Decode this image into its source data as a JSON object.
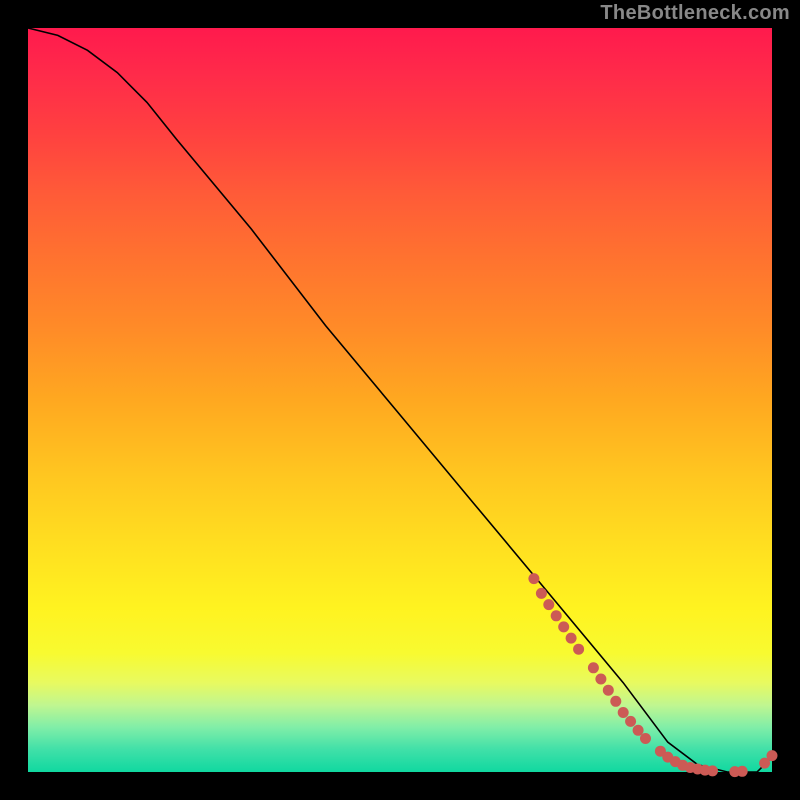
{
  "attribution": "TheBottleneck.com",
  "chart_data": {
    "type": "line",
    "title": "",
    "xlabel": "",
    "ylabel": "",
    "xlim": [
      0,
      100
    ],
    "ylim": [
      0,
      100
    ],
    "grid": false,
    "legend": false,
    "series": [
      {
        "name": "curve",
        "kind": "line",
        "x": [
          0,
          4,
          8,
          12,
          16,
          20,
          30,
          40,
          50,
          60,
          70,
          80,
          86,
          90,
          94,
          98,
          100
        ],
        "y": [
          100,
          99,
          97,
          94,
          90,
          85,
          73,
          60,
          48,
          36,
          24,
          12,
          4,
          1,
          0,
          0,
          2
        ]
      },
      {
        "name": "markers",
        "kind": "scatter",
        "points": [
          {
            "x": 68,
            "y": 26
          },
          {
            "x": 69,
            "y": 24
          },
          {
            "x": 70,
            "y": 22.5
          },
          {
            "x": 71,
            "y": 21
          },
          {
            "x": 72,
            "y": 19.5
          },
          {
            "x": 73,
            "y": 18
          },
          {
            "x": 74,
            "y": 16.5
          },
          {
            "x": 76,
            "y": 14
          },
          {
            "x": 77,
            "y": 12.5
          },
          {
            "x": 78,
            "y": 11
          },
          {
            "x": 79,
            "y": 9.5
          },
          {
            "x": 80,
            "y": 8
          },
          {
            "x": 81,
            "y": 6.8
          },
          {
            "x": 82,
            "y": 5.6
          },
          {
            "x": 83,
            "y": 4.5
          },
          {
            "x": 85,
            "y": 2.8
          },
          {
            "x": 86,
            "y": 2
          },
          {
            "x": 87,
            "y": 1.4
          },
          {
            "x": 88,
            "y": 0.9
          },
          {
            "x": 89,
            "y": 0.6
          },
          {
            "x": 90,
            "y": 0.4
          },
          {
            "x": 91,
            "y": 0.25
          },
          {
            "x": 92,
            "y": 0.15
          },
          {
            "x": 95,
            "y": 0.05
          },
          {
            "x": 96,
            "y": 0.1
          },
          {
            "x": 99,
            "y": 1.2
          },
          {
            "x": 100,
            "y": 2.2
          }
        ]
      }
    ]
  }
}
